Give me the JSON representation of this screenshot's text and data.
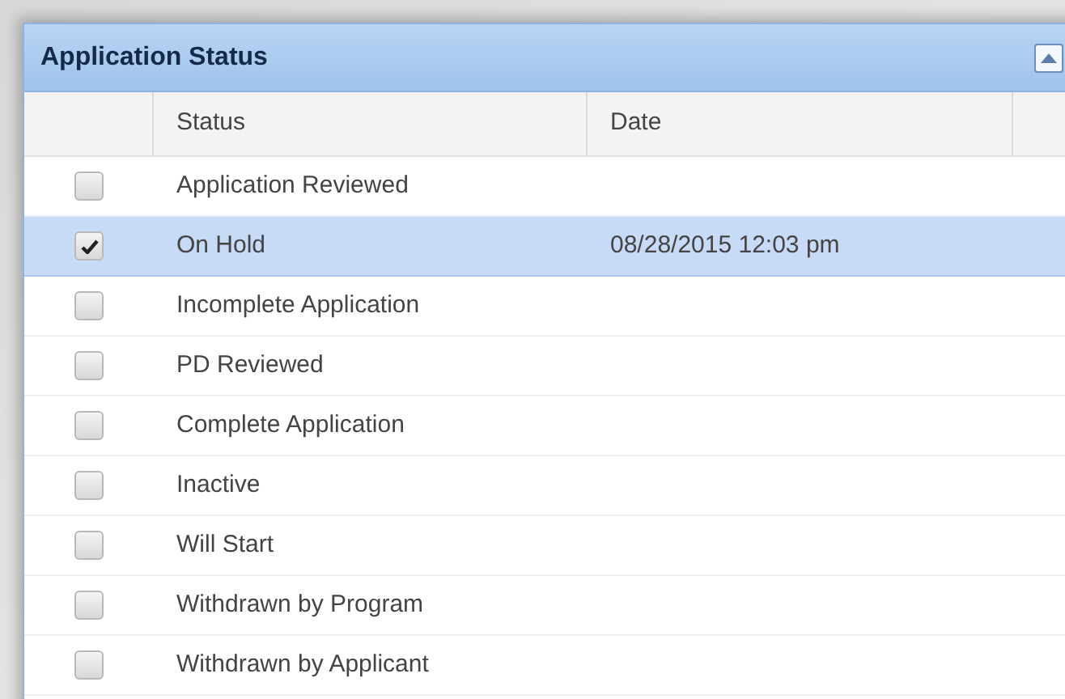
{
  "panel": {
    "title": "Application Status"
  },
  "table": {
    "columns": [
      "Status",
      "Date"
    ],
    "rows": [
      {
        "status": "Application Reviewed",
        "date": "",
        "checked": false,
        "selected": false
      },
      {
        "status": "On Hold",
        "date": "08/28/2015 12:03 pm",
        "checked": true,
        "selected": true
      },
      {
        "status": "Incomplete Application",
        "date": "",
        "checked": false,
        "selected": false
      },
      {
        "status": "PD Reviewed",
        "date": "",
        "checked": false,
        "selected": false
      },
      {
        "status": "Complete Application",
        "date": "",
        "checked": false,
        "selected": false
      },
      {
        "status": "Inactive",
        "date": "",
        "checked": false,
        "selected": false
      },
      {
        "status": "Will Start",
        "date": "",
        "checked": false,
        "selected": false
      },
      {
        "status": "Withdrawn by Program",
        "date": "",
        "checked": false,
        "selected": false
      },
      {
        "status": "Withdrawn by Applicant",
        "date": "",
        "checked": false,
        "selected": false
      }
    ]
  }
}
